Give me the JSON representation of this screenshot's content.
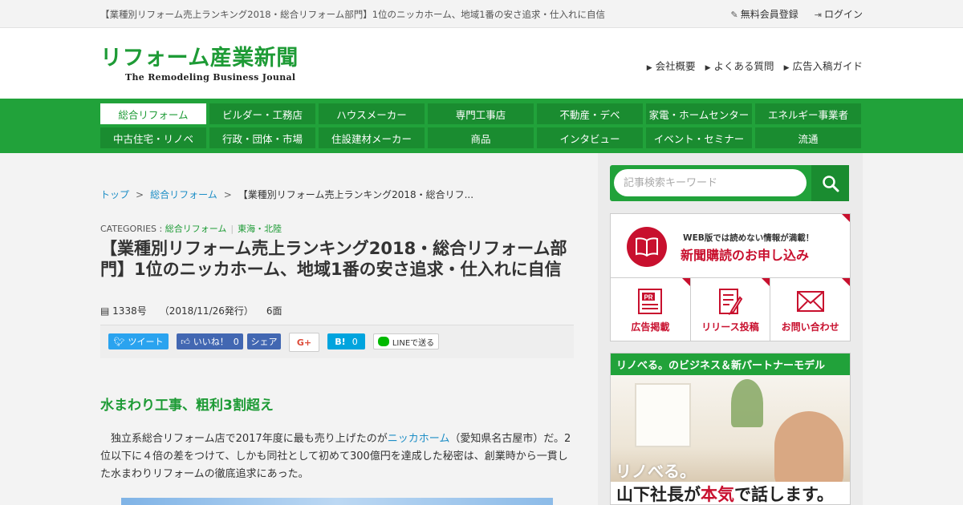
{
  "topbar": {
    "headline": "【業種別リフォーム売上ランキング2018・総合リフォーム部門】1位のニッカホーム、地域1番の安さ追求・仕入れに自信",
    "register": "無料会員登録",
    "login": "ログイン"
  },
  "header": {
    "logo_title": "リフォーム産業新聞",
    "logo_sub": "The Remodeling Business Jounal",
    "links": [
      "会社概要",
      "よくある質問",
      "広告入稿ガイド"
    ]
  },
  "nav": {
    "items": [
      "総合リフォーム",
      "ビルダー・工務店",
      "ハウスメーカー",
      "専門工事店",
      "不動産・デベ",
      "家電・ホームセンター",
      "エネルギー事業者",
      "中古住宅・リノベ",
      "行政・団体・市場",
      "住設建材メーカー",
      "商品",
      "インタビュー",
      "イベント・セミナー",
      "流通"
    ],
    "active_index": 0
  },
  "breadcrumb": {
    "home": "トップ",
    "sep": ">",
    "category": "総合リフォーム",
    "current": "【業種別リフォーム売上ランキング2018・総合リフ..."
  },
  "categories": {
    "label": "CATEGORIES :",
    "items": [
      "総合リフォーム",
      "東海・北陸"
    ],
    "separator": "|"
  },
  "article": {
    "title": "【業種別リフォーム売上ランキング2018・総合リフォーム部門】1位のニッカホーム、地域1番の安さ追求・仕入れに自信",
    "issue": "1338号",
    "date": "（2018/11/26発行）",
    "page": "6面",
    "subheading": "水まわり工事、粗利3割超え",
    "body_pre": "独立系総合リフォーム店で2017年度に最も売り上げたのが",
    "body_link": "ニッカホーム",
    "body_post": "（愛知県名古屋市）だ。2位以下に４倍の差をつけて、しかも同社として初めて300億円を達成した秘密は、創業時から一貫した水まわりリフォームの徹底追求にあった。"
  },
  "share": {
    "tweet": "ツイート",
    "like": "いいね！",
    "like_count": "0",
    "fb_share": "シェア",
    "gplus": "G+",
    "hatena": "B!",
    "hatena_count": "0",
    "line": "LINEで送る"
  },
  "sidebar": {
    "search_placeholder": "記事検索キーワード",
    "subscribe_small": "WEB版では読めない情報が満載！",
    "subscribe_big": "新聞購読のお申し込み",
    "cells": [
      "広告掲載",
      "リリース投稿",
      "お問い合わせ"
    ],
    "pr_tag": "PR",
    "reno_head": "リノべる。のビジネス＆新パートナーモデル",
    "reno_logo": "リノべる。",
    "reno_bottom_pre": "山下社長が",
    "reno_bottom_hl": "本気",
    "reno_bottom_post": "で話します。"
  },
  "colors": {
    "brand_green": "#1e9b36",
    "nav_green": "#21a23a",
    "link_blue": "#1d8ec6",
    "accent_red": "#c8102e"
  }
}
